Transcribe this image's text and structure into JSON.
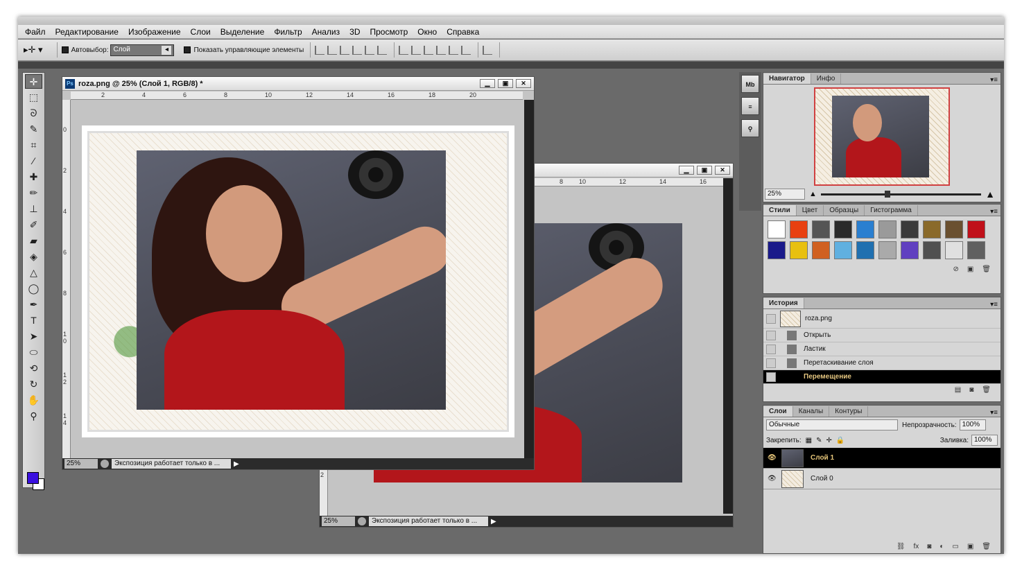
{
  "menu": [
    "Файл",
    "Редактирование",
    "Изображение",
    "Слои",
    "Выделение",
    "Фильтр",
    "Анализ",
    "3D",
    "Просмотр",
    "Окно",
    "Справка"
  ],
  "options": {
    "autoselect_label": "Автовыбор:",
    "autoselect_value": "Слой",
    "show_controls_label": "Показать управляющие элементы"
  },
  "doc1": {
    "title": "roza.png @ 25% (Слой 1, RGB/8) *",
    "zoom": "25%",
    "status": "Экспозиция работает только в ...",
    "ruler_h": [
      "2",
      "4",
      "6",
      "8",
      "10",
      "12",
      "14",
      "16",
      "18",
      "20"
    ],
    "ruler_v": [
      "0",
      "2",
      "4",
      "6",
      "8",
      "1 0",
      "1 2",
      "1 4"
    ]
  },
  "doc2": {
    "zoom": "25%",
    "status": "Экспозиция работает только в ...",
    "ruler_h": [
      "8",
      "10",
      "12",
      "14",
      "16"
    ],
    "ruler_v": [
      "2"
    ]
  },
  "navigator": {
    "tabs": [
      "Навигатор",
      "Инфо"
    ],
    "zoom": "25%"
  },
  "styles": {
    "tabs": [
      "Стили",
      "Цвет",
      "Образцы",
      "Гистограмма"
    ],
    "swatch_colors": [
      "#ffffff",
      "#e84010",
      "#555555",
      "#2a2a2a",
      "#2a7fd0",
      "#9a9a9a",
      "#3a3a3a",
      "#8a6a2a",
      "#6a5030",
      "#c0101a",
      "#1a1a8a",
      "#e8c010",
      "#d06020",
      "#60b0e0",
      "#2070b0",
      "#aaaaaa",
      "#6040c0",
      "#505050",
      "#e0e0e0",
      "#606060"
    ]
  },
  "history": {
    "tab": "История",
    "snapshot": "roza.png",
    "items": [
      "Открыть",
      "Ластик",
      "Перетаскивание слоя",
      "Перемещение"
    ]
  },
  "layers": {
    "tabs": [
      "Слои",
      "Каналы",
      "Контуры"
    ],
    "blend": "Обычные",
    "opacity_label": "Непрозрачность:",
    "opacity": "100%",
    "lock_label": "Закрепить:",
    "fill_label": "Заливка:",
    "fill": "100%",
    "items": [
      "Слой 1",
      "Слой 0"
    ]
  },
  "toolbox_icons": [
    "move-icon",
    "marquee-icon",
    "lasso-icon",
    "quick-select-icon",
    "crop-icon",
    "eyedropper-icon",
    "healing-icon",
    "brush-icon",
    "stamp-icon",
    "history-brush-icon",
    "eraser-icon",
    "bucket-icon",
    "blur-icon",
    "dodge-icon",
    "pen-icon",
    "type-icon",
    "path-select-icon",
    "shape-icon",
    "3d-rotate-icon",
    "3d-orbit-icon",
    "hand-icon",
    "zoom-icon"
  ],
  "colors": {
    "foreground": "#3a10e0",
    "background": "#ffffff"
  }
}
